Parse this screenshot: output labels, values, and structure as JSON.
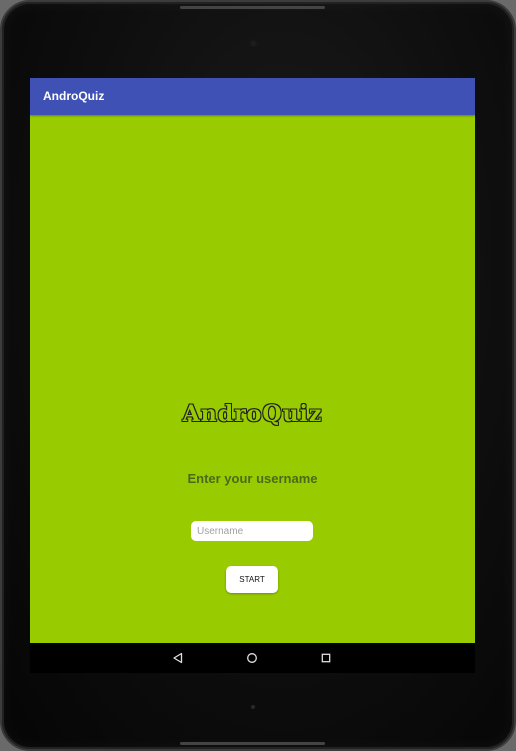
{
  "app_bar": {
    "title": "AndroQuiz",
    "color": "#3f51b5"
  },
  "main": {
    "background": "#99cc00",
    "logo_text": "AndroQuiz",
    "prompt": "Enter your username",
    "username_input": {
      "value": "",
      "placeholder": "Username"
    },
    "start_button_label": "START"
  },
  "nav_bar": {
    "icons": [
      "back-triangle-icon",
      "home-circle-icon",
      "recent-apps-square-icon"
    ]
  }
}
